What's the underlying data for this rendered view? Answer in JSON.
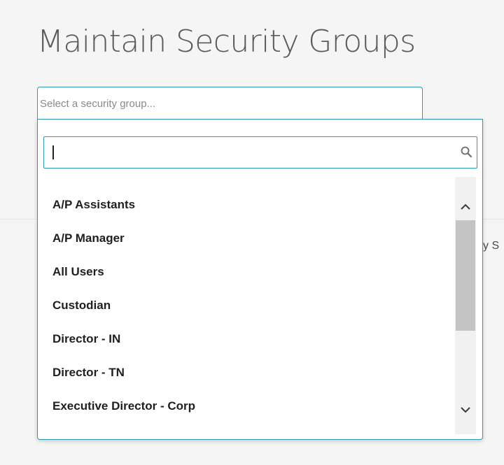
{
  "page": {
    "title": "Maintain Security Groups",
    "background_fragment": "y S"
  },
  "security_group_select": {
    "placeholder": "Select a security group...",
    "search": {
      "value": "",
      "icon": "search-icon"
    },
    "options": [
      "A/P Assistants",
      "A/P Manager",
      "All Users",
      "Custodian",
      "Director - IN",
      "Director - TN",
      "Executive Director - Corp"
    ],
    "scrollbar": {
      "up_icon": "chevron-up-icon",
      "down_icon": "chevron-down-icon"
    }
  },
  "colors": {
    "accent_border": "#2a9bb0",
    "title_text": "#5a5a5a",
    "option_text": "#1f1f1f",
    "page_background": "#f5f5f5",
    "scroll_thumb": "#c4c4c4"
  }
}
